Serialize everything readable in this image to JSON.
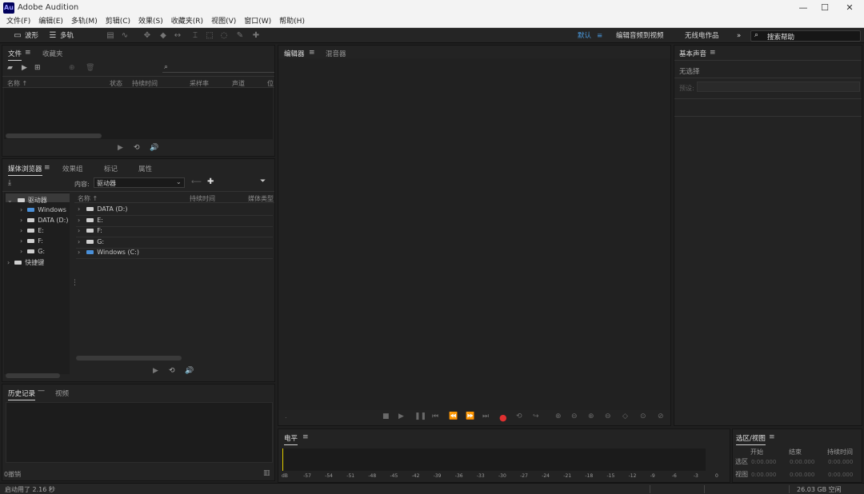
{
  "app": {
    "title": "Adobe Audition",
    "logo": "Au"
  },
  "window_controls": [
    "—",
    "☐",
    "✕"
  ],
  "menu": [
    "文件(F)",
    "编辑(E)",
    "多轨(M)",
    "剪辑(C)",
    "效果(S)",
    "收藏夹(R)",
    "视图(V)",
    "窗口(W)",
    "帮助(H)"
  ],
  "toolbar": {
    "waveform_label": "波形",
    "multitrack_label": "多轨",
    "workspaces": [
      "默认",
      "编辑音频到视频",
      "无线电作品"
    ],
    "more": "»",
    "search_placeholder": "搜索帮助"
  },
  "files_panel": {
    "tabs": [
      "文件",
      "收藏夹"
    ],
    "columns": [
      "名称 ↑",
      "状态",
      "持续时间",
      "采样率",
      "声道",
      "位"
    ]
  },
  "media_browser": {
    "tabs": [
      "媒体浏览器",
      "效果组",
      "标记",
      "属性"
    ],
    "content_label": "内容:",
    "content_value": "驱动器",
    "left_tree": [
      {
        "label": "驱动器",
        "expanded": true,
        "level": 0
      },
      {
        "label": "Windows",
        "level": 1,
        "win": true
      },
      {
        "label": "DATA (D:)",
        "level": 1
      },
      {
        "label": "E:",
        "level": 1
      },
      {
        "label": "F:",
        "level": 1
      },
      {
        "label": "G:",
        "level": 1
      },
      {
        "label": "快捷键",
        "expanded": false,
        "level": 0
      }
    ],
    "columns": [
      "名称 ↑",
      "持续时间",
      "媒体类型"
    ],
    "right_list": [
      {
        "label": "DATA (D:)",
        "win": false
      },
      {
        "label": "E:",
        "win": false
      },
      {
        "label": "F:",
        "win": false
      },
      {
        "label": "G:",
        "win": false
      },
      {
        "label": "Windows (C:)",
        "win": true
      }
    ]
  },
  "history_panel": {
    "tabs": [
      "历史记录",
      "视频"
    ],
    "status": "0撤销"
  },
  "editor_panel": {
    "tabs": [
      "编辑器",
      "混音器"
    ]
  },
  "basic_sound": {
    "title": "基本声音",
    "subtitle": "无选择",
    "preset_label": "预设:"
  },
  "levels_panel": {
    "title": "电平",
    "ruler": [
      "dB",
      "-57",
      "-54",
      "-51",
      "-48",
      "-45",
      "-42",
      "-39",
      "-36",
      "-33",
      "-30",
      "-27",
      "-24",
      "-21",
      "-18",
      "-15",
      "-12",
      "-9",
      "-6",
      "-3",
      "0"
    ]
  },
  "selection_panel": {
    "title": "选区/视图",
    "columns": [
      "开始",
      "结束",
      "持续时间"
    ],
    "rows": [
      {
        "label": "选区",
        "start": "0:00.000",
        "end": "0:00.000",
        "duration": "0:00.000"
      },
      {
        "label": "视图",
        "start": "0:00.000",
        "end": "0:00.000",
        "duration": "0:00.000"
      }
    ]
  },
  "status_bar": {
    "left": "启动用了 2.16 秒",
    "right": "26.03 GB 空闲"
  },
  "colors": {
    "accent": "#4a90d9",
    "record": "#e03030",
    "playhead": "#e6d000",
    "background": "#1f1f1f"
  }
}
